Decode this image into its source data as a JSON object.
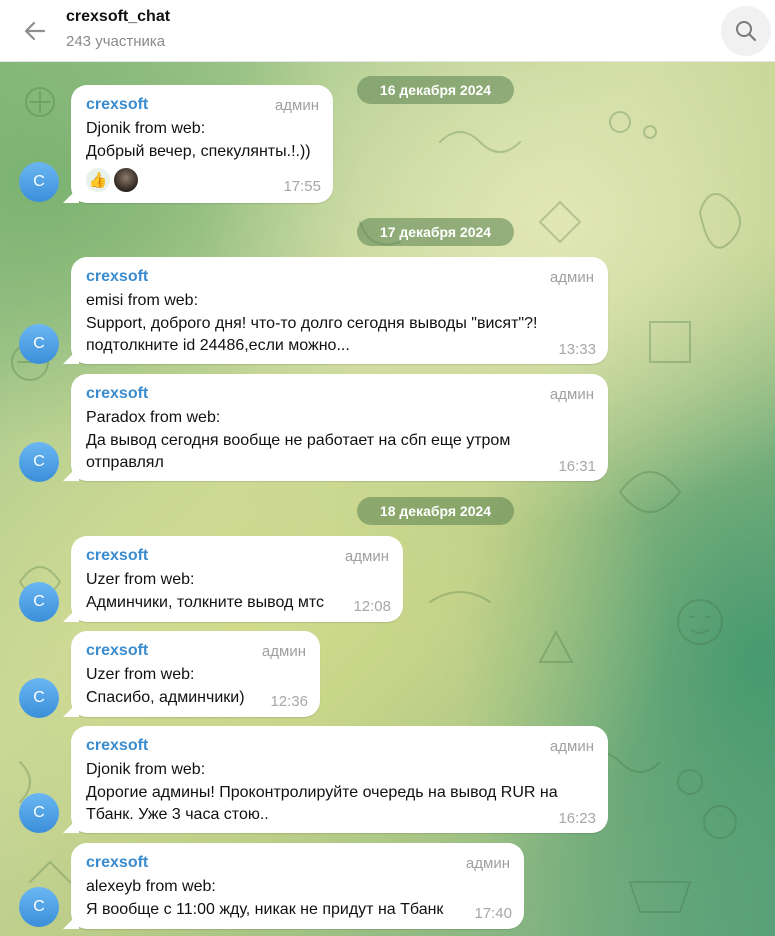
{
  "header": {
    "title": "crexsoft_chat",
    "subtitle": "243 участника",
    "back_icon": "arrow-left-icon",
    "search_icon": "search-icon"
  },
  "dates": [
    "16 декабря 2024",
    "17 декабря 2024",
    "18 декабря 2024"
  ],
  "messages": [
    {
      "sender": "crexsoft",
      "role": "админ",
      "text": "Djonik from web:\nДобрый вечер, спекулянты.!.))",
      "time": "17:55",
      "avatar": "C",
      "reaction": "👍"
    },
    {
      "sender": "crexsoft",
      "role": "админ",
      "text": "emisi from web:\nSupport, доброго дня! что-то долго сегодня выводы \"висят\"?!\nподтолкните id 24486,если можно...",
      "time": "13:33",
      "avatar": "C"
    },
    {
      "sender": "crexsoft",
      "role": "админ",
      "text": "Paradox from web:\nДа вывод сегодня вообще не работает на сбп еще утром\nотправлял",
      "time": "16:31",
      "avatar": "C"
    },
    {
      "sender": "crexsoft",
      "role": "админ",
      "text": "Uzer from web:\nАдминчики, толкните вывод мтс",
      "time": "12:08",
      "avatar": "C"
    },
    {
      "sender": "crexsoft",
      "role": "админ",
      "text": "Uzer from web:\nСпасибо, админчики)",
      "time": "12:36",
      "avatar": "C"
    },
    {
      "sender": "crexsoft",
      "role": "админ",
      "text": "Djonik from web:\nДорогие админы! Проконтролируйте очередь на вывод RUR на\nТбанк. Уже 3 часа стою..",
      "time": "16:23",
      "avatar": "C"
    },
    {
      "sender": "crexsoft",
      "role": "админ",
      "text": "alexeyb from web:\nЯ вообще с 11:00 жду, никак не придут на Тбанк",
      "time": "17:40",
      "avatar": "C"
    }
  ],
  "colors": {
    "sender_name": "#3a8ccf",
    "avatar": "#4a9ee3",
    "bubble": "#ffffff"
  }
}
